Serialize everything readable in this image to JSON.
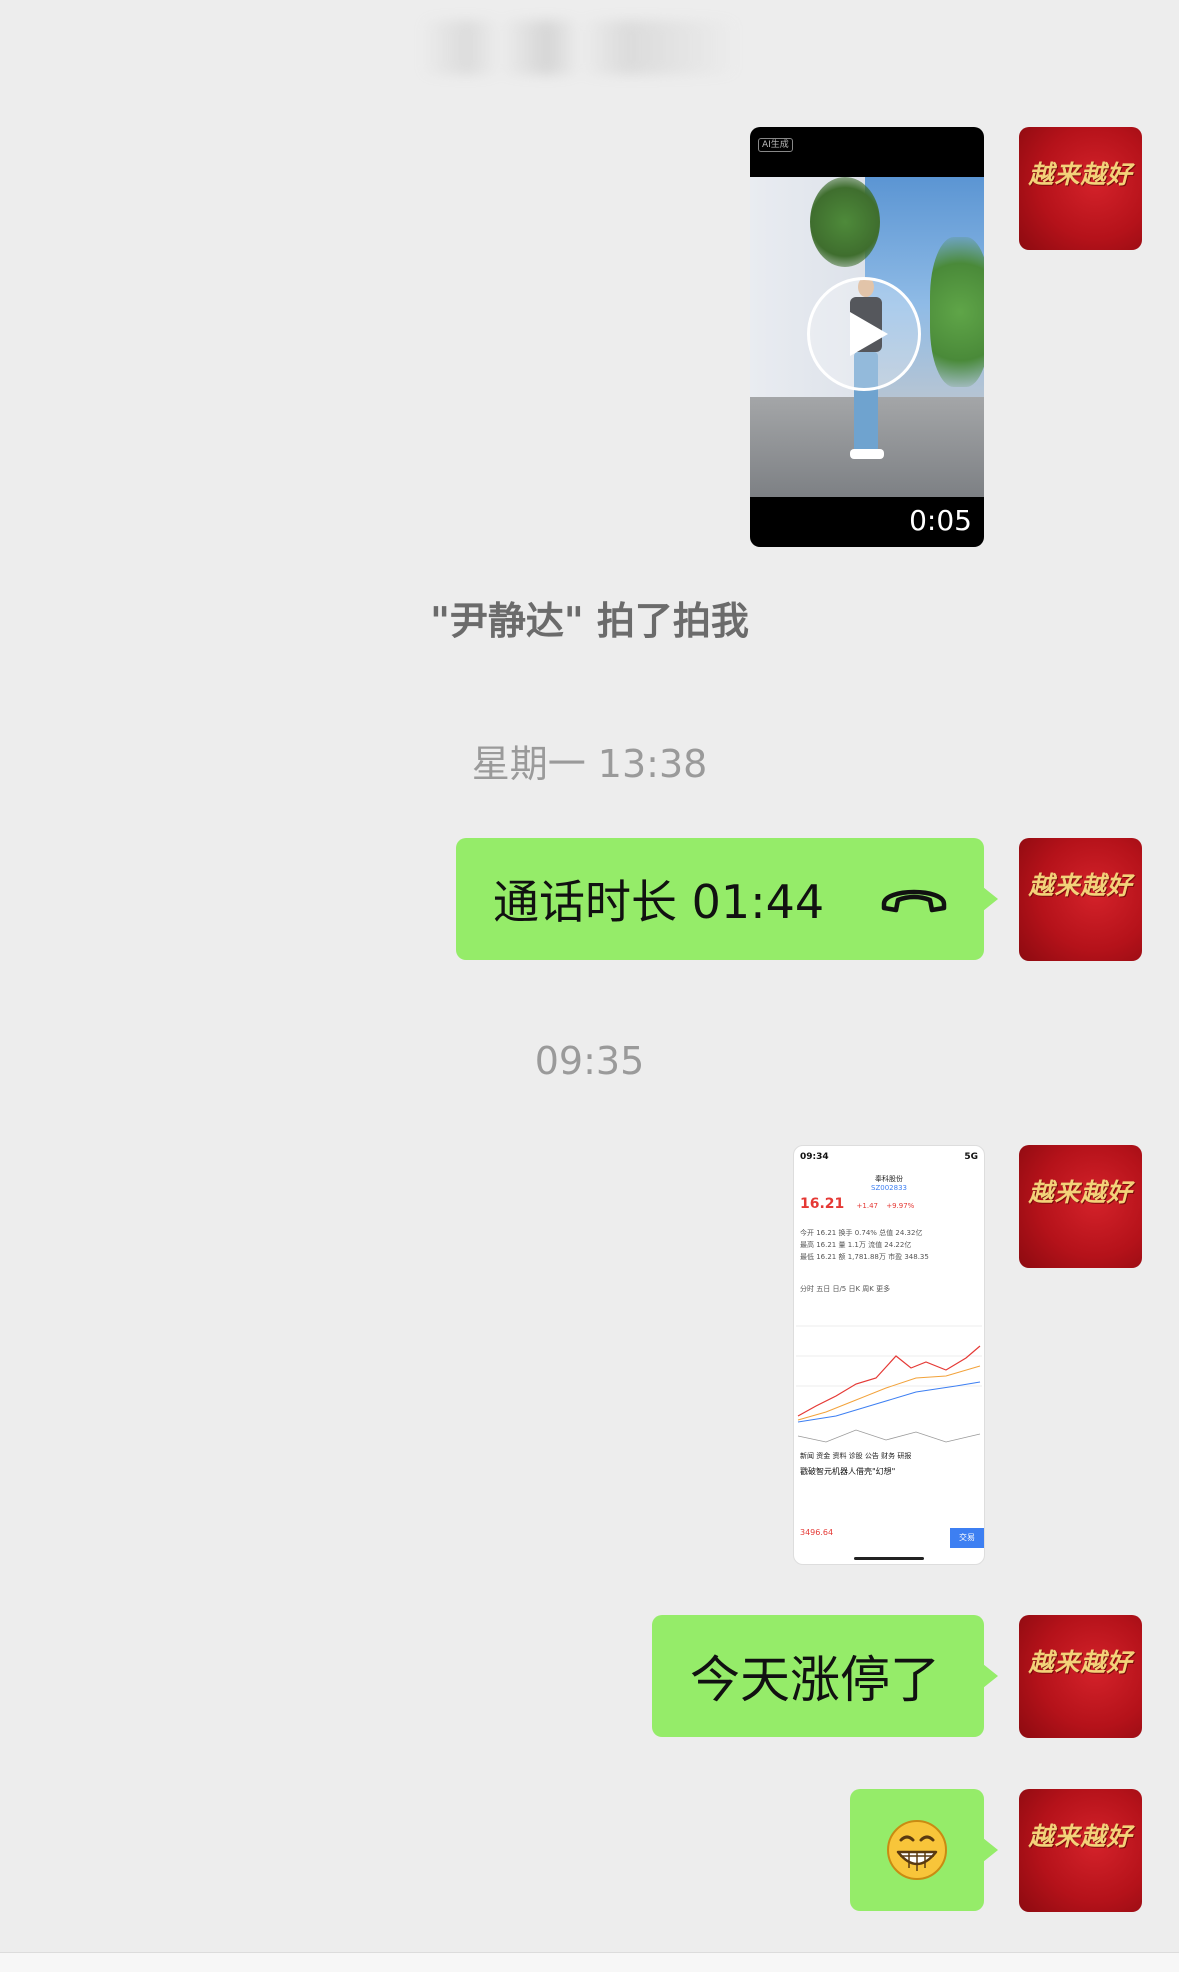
{
  "chat": {
    "title": "",
    "avatar_text": "越来越好",
    "messages": {
      "video_tag": "AI生成",
      "video_duration": "0:05",
      "pat_text": "\"尹静达\" 拍了拍我",
      "timestamp_1": "星期一 13:38",
      "call_label": "通话时长 01:44",
      "timestamp_2": "09:35",
      "text_1": "今天涨停了",
      "emoji": "😁"
    }
  },
  "screenshot": {
    "time": "09:34",
    "signal": "5G",
    "stock_name": "奉科股份",
    "stock_code": "SZ002833",
    "price": "16.21",
    "change": "+1.47",
    "change_pct": "+9.97%",
    "stats_row1": "今开 16.21   换手 0.74%   总值 24.32亿",
    "stats_row2": "最高 16.21   量 1.1万   流值 24.22亿",
    "stats_row3": "最低 16.21   额 1,781.88万   市盈 348.35",
    "tabs": "分时  五日  日/5  日K  周K  更多",
    "news_tabs": "新闻  资金  资料  诊股  公告  财务  研报",
    "headline": "戳破智元机器人借壳\"幻想\"",
    "index_value": "3496.64",
    "trade_label": "交易"
  },
  "colors": {
    "bubble_green": "#95ec69",
    "background": "#ededed",
    "avatar_red": "#b5121a"
  }
}
